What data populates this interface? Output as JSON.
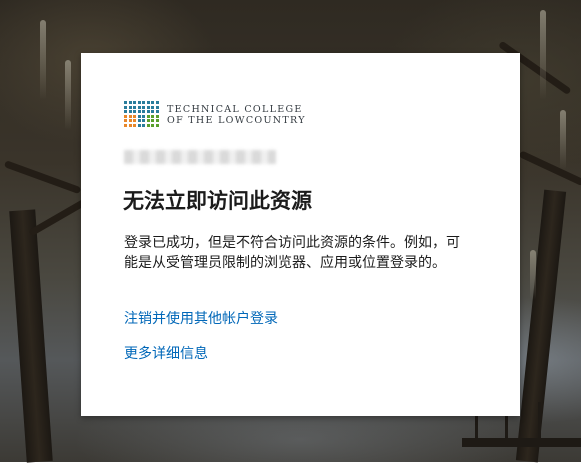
{
  "logo": {
    "line1": "TECHNICAL COLLEGE",
    "line2": "OF THE LOWCOUNTRY",
    "colors": {
      "teal": "#2a7d9c",
      "orange": "#e8872a",
      "green": "#5aa02c"
    }
  },
  "dialog": {
    "title": "无法立即访问此资源",
    "message": "登录已成功，但是不符合访问此资源的条件。例如，可能是从受管理员限制的浏览器、应用或位置登录的。",
    "signout_link": "注销并使用其他帐户登录",
    "details_link": "更多详细信息"
  },
  "colors": {
    "link": "#0067b8",
    "text": "#1b1b1b",
    "card_bg": "#ffffff"
  }
}
